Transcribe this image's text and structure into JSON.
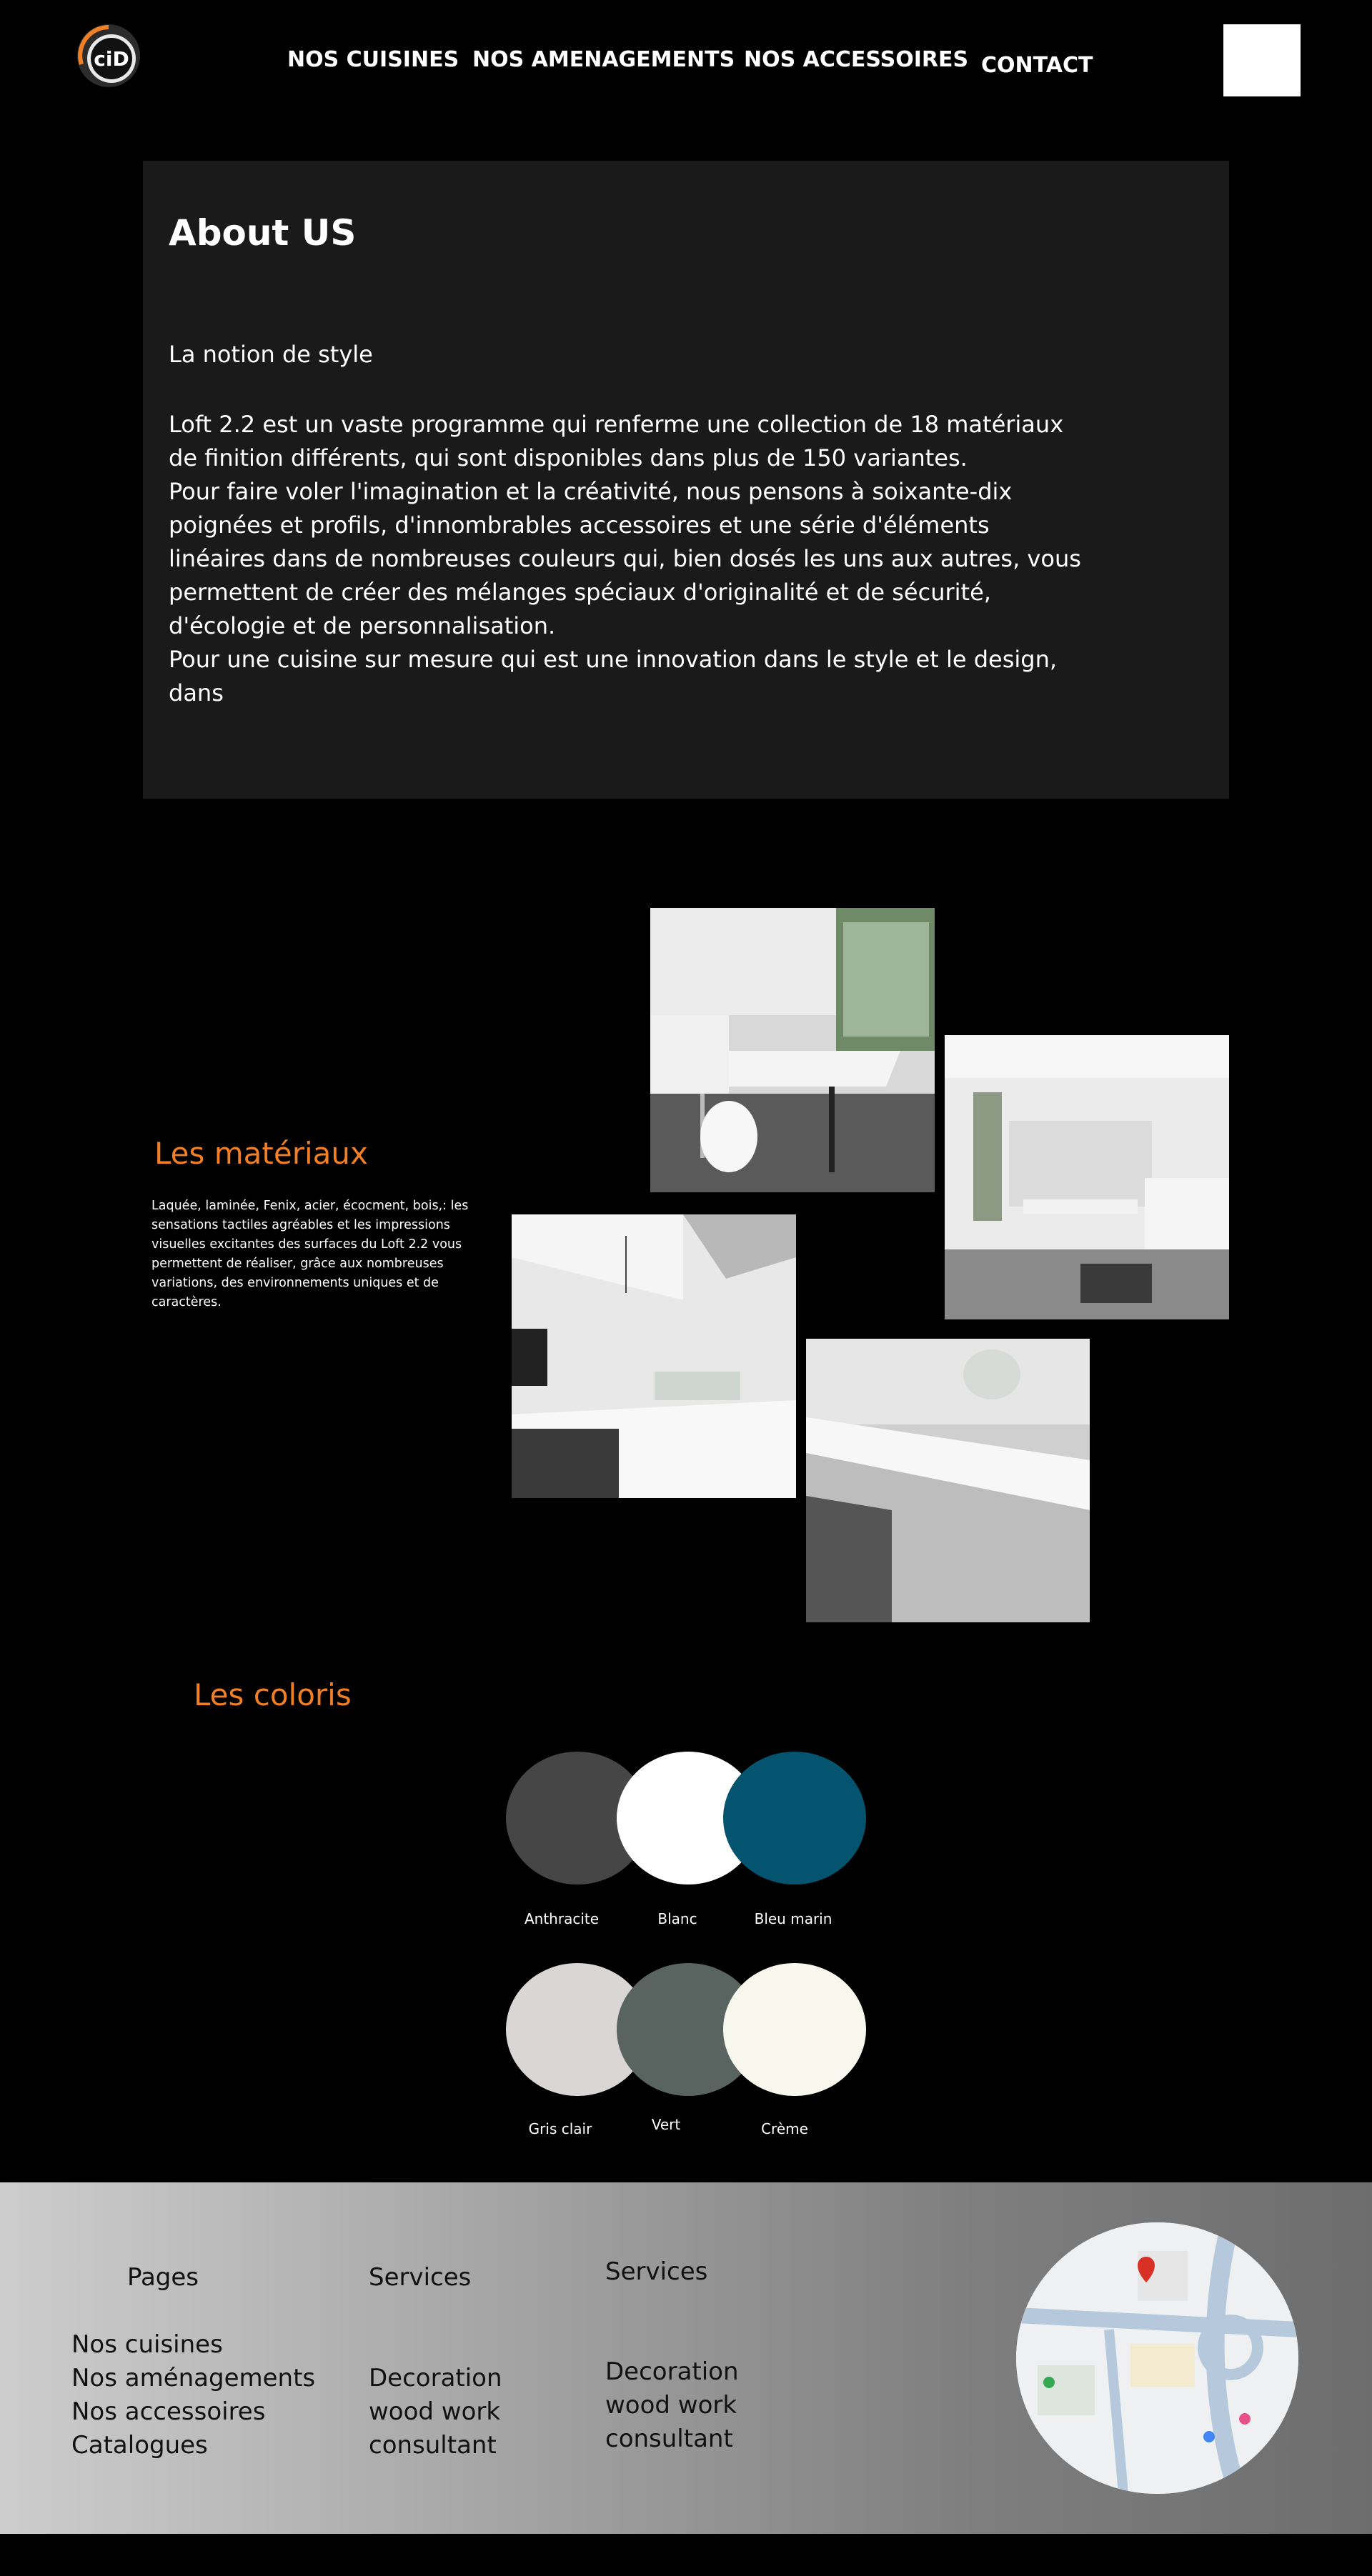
{
  "header": {
    "logo_text": "ciD",
    "nav": [
      "NOS CUISINES",
      "NOS AMENAGEMENTS",
      "NOS ACCESSOIRES",
      "CONTACT"
    ]
  },
  "about": {
    "title": "About US",
    "subtitle": "La notion de style",
    "paragraphs": [
      "Loft 2.2 est un vaste programme qui renferme une collection de 18 matériaux de finition différents, qui sont disponibles dans plus de 150 variantes.",
      "Pour faire voler l'imagination et la créativité, nous pensons à soixante-dix poignées et profils, d'innombrables accessoires et une série d'éléments linéaires dans de nombreuses couleurs qui, bien dosés les uns aux autres, vous permettent de créer des mélanges spéciaux d'originalité et de sécurité, d'écologie et de personnalisation.",
      "Pour une cuisine sur mesure qui est une innovation dans le style et le design, dans"
    ]
  },
  "materiaux": {
    "title": "Les matériaux",
    "text": "Laquée, laminée, Fenix, acier, écocment, bois,: les sensations tactiles agréables et les impressions visuelles excitantes des surfaces du Loft 2.2 vous permettent de réaliser, grâce aux nombreuses variations, des environnements uniques et de caractères."
  },
  "coloris": {
    "title": "Les coloris",
    "swatches": [
      {
        "label": "Anthracite",
        "color": "#464646"
      },
      {
        "label": "Blanc",
        "color": "#ffffff"
      },
      {
        "label": "Bleu marin",
        "color": "#04536f"
      },
      {
        "label": "Gris clair",
        "color": "#d9d6d5"
      },
      {
        "label": "Vert",
        "color": "#596460"
      },
      {
        "label": "Crème",
        "color": "#f8f7ed"
      }
    ]
  },
  "footer": {
    "col1": {
      "title": "Pages",
      "items": [
        "Nos cuisines",
        "Nos aménagements",
        "Nos accessoires",
        "Catalogues"
      ]
    },
    "col2": {
      "title": "Services",
      "items": [
        "Decoration",
        "wood work",
        "consultant"
      ]
    },
    "col3": {
      "title": "Services",
      "items": [
        "Decoration",
        "wood work",
        "consultant"
      ]
    }
  },
  "colors": {
    "accent": "#f07f26",
    "panel": "#1a1a1a",
    "background": "#000000"
  }
}
